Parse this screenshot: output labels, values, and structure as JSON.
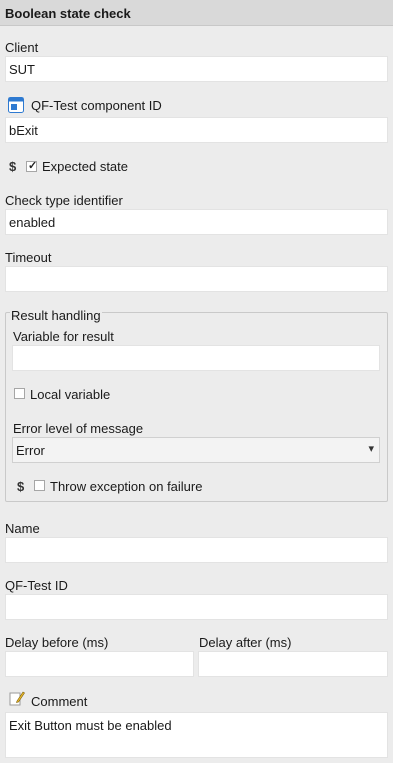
{
  "header": {
    "title": "Boolean state check"
  },
  "client": {
    "label": "Client",
    "value": "SUT"
  },
  "component": {
    "label": "QF-Test component ID",
    "value": "bExit"
  },
  "expected_state": {
    "symbol": "$",
    "label": "Expected state",
    "checked": true,
    "check_mark": "✓"
  },
  "check_type": {
    "label": "Check type identifier",
    "value": "enabled"
  },
  "timeout": {
    "label": "Timeout",
    "value": ""
  },
  "result_handling": {
    "title": "Result handling",
    "variable_label": "Variable for result",
    "variable_value": "",
    "local_variable_label": "Local variable",
    "error_level_label": "Error level of message",
    "error_level_value": "Error",
    "throw_symbol": "$",
    "throw_label": "Throw exception on failure"
  },
  "name": {
    "label": "Name",
    "value": ""
  },
  "qftest_id": {
    "label": "QF-Test ID",
    "value": ""
  },
  "delay_before": {
    "label": "Delay before (ms)",
    "value": ""
  },
  "delay_after": {
    "label": "Delay after (ms)",
    "value": ""
  },
  "comment": {
    "label": "Comment",
    "value": "Exit Button must be enabled"
  },
  "icons": {
    "component": "component-window-icon",
    "comment": "pencil-note-icon",
    "chevron": "▾"
  },
  "colors": {
    "component_icon": "#2e7ad1",
    "pencil": "#e8b92c"
  }
}
